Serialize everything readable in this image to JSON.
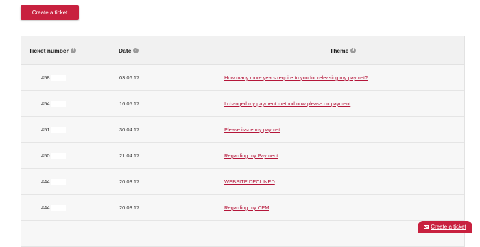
{
  "create_button_label": "Create a ticket",
  "table": {
    "headers": {
      "ticket_number": "Ticket number",
      "date": "Date",
      "theme": "Theme"
    },
    "rows": [
      {
        "number": "#58",
        "date": "03.06.17",
        "theme": "How many more years require to you for releasing my paymet?"
      },
      {
        "number": "#54",
        "date": "16.05.17",
        "theme": "I changed my payment method now please do payment"
      },
      {
        "number": "#51",
        "date": "30.04.17",
        "theme": "Please issue my paymet"
      },
      {
        "number": "#50",
        "date": "21.04.17",
        "theme": "Regarding my Payment"
      },
      {
        "number": "#44",
        "date": "20.03.17",
        "theme": "WEBSITE DECLINED"
      },
      {
        "number": "#44",
        "date": "20.03.17",
        "theme": "Regarding my CPM"
      },
      {
        "number": "",
        "date": "",
        "theme": ""
      }
    ]
  },
  "floating_button_label": "Create a ticket",
  "colors": {
    "accent": "#c8213f",
    "link": "#b5163a",
    "header_bg": "#f1f1f1",
    "row_bg": "#f7f7f7"
  }
}
